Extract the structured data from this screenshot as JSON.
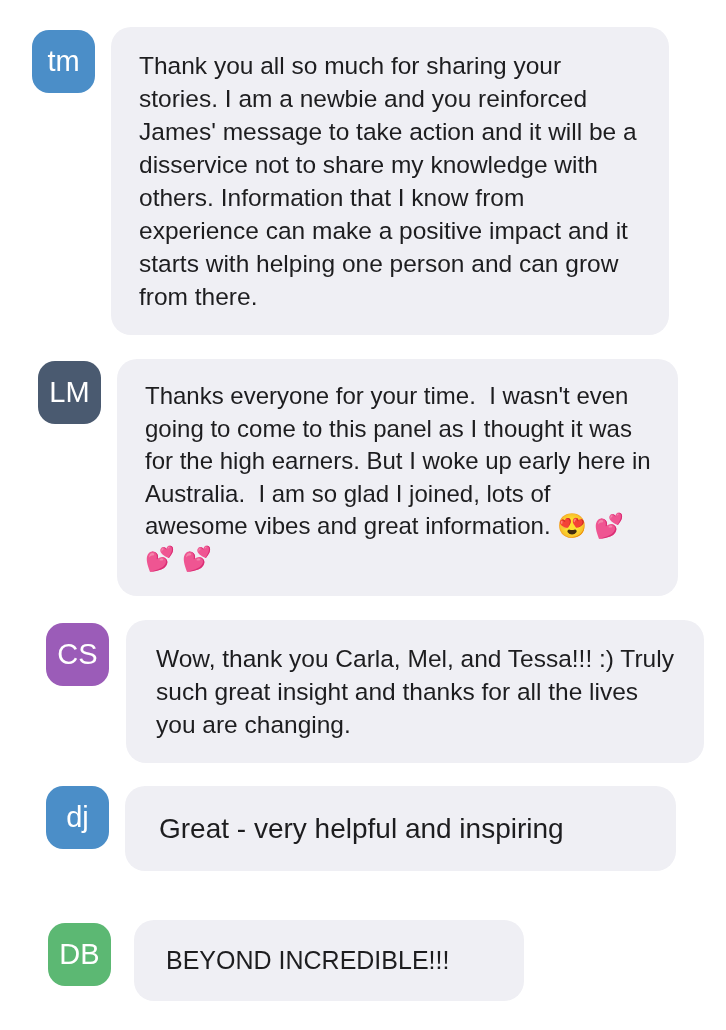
{
  "messages": [
    {
      "initials": "tm",
      "color": "#4b8ec8",
      "text": "Thank you all so much for sharing your stories. I am a newbie and you reinforced James' message to take action and it will be a disservice not to share my knowledge with others. Information that I know from experience can make a positive impact and it starts with helping one person and can grow from there."
    },
    {
      "initials": "LM",
      "color": "#4a5a70",
      "text": "Thanks everyone for your time.  I wasn't even going to come to this panel as I thought it was for the high earners. But I woke up early here in Australia.  I am so glad I joined, lots of awesome vibes and great information. 😍 💕 💕 💕"
    },
    {
      "initials": "CS",
      "color": "#9b5cb8",
      "text": "Wow, thank you Carla, Mel, and Tessa!!! :) Truly such great insight and thanks for all the lives you are changing."
    },
    {
      "initials": "dj",
      "color": "#4b8ec8",
      "text": "Great - very helpful and inspiring"
    },
    {
      "initials": "DB",
      "color": "#5cb873",
      "text": "BEYOND INCREDIBLE!!!"
    }
  ]
}
